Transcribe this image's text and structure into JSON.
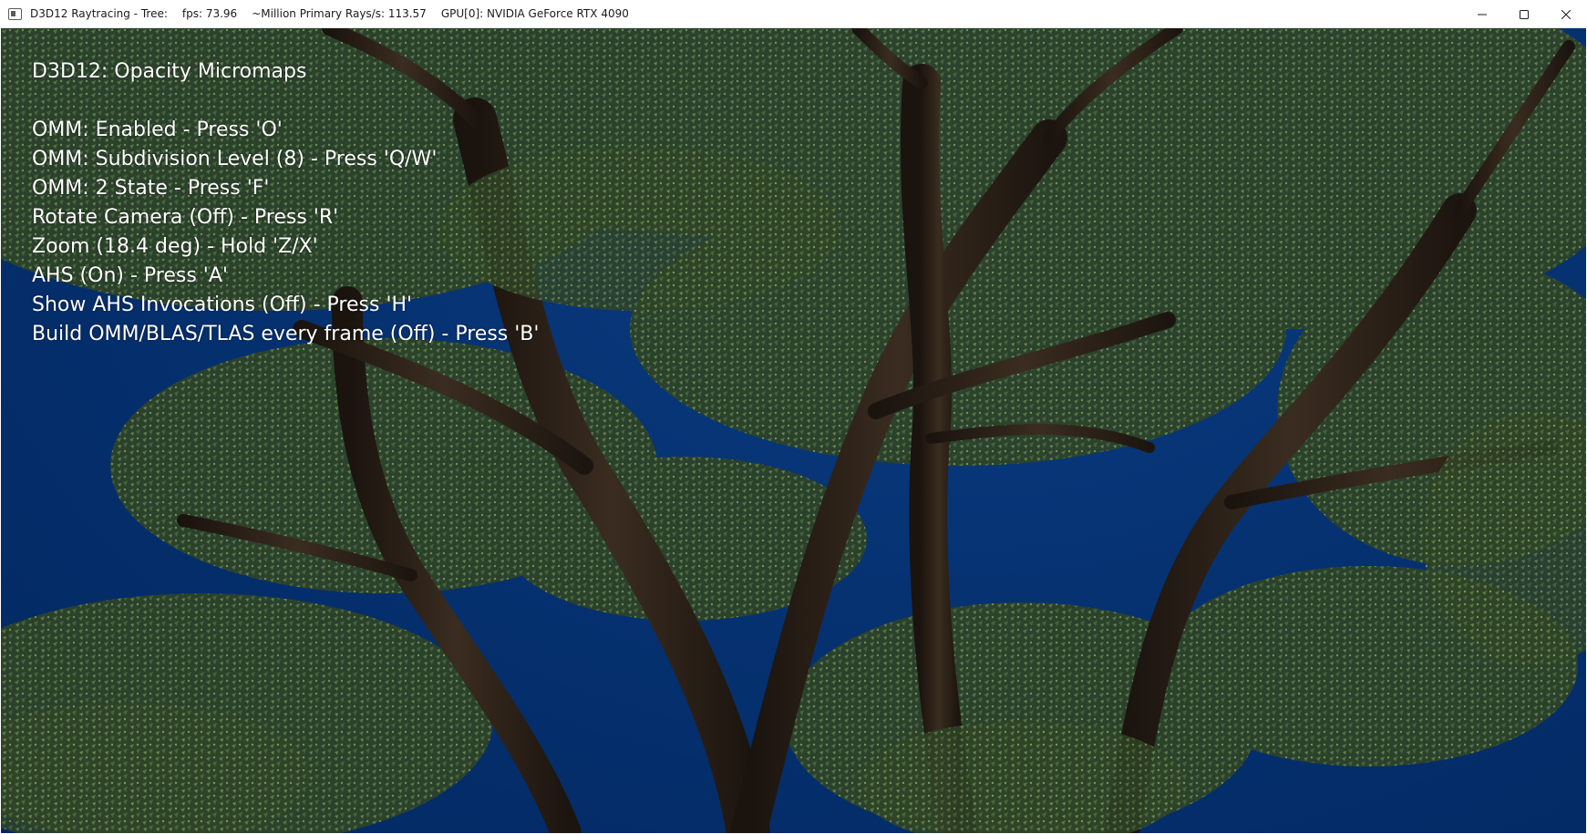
{
  "window": {
    "title_segments": [
      "D3D12 Raytracing - Tree:",
      "fps: 73.96",
      "~Million Primary Rays/s: 113.57",
      "GPU[0]: NVIDIA GeForce RTX 4090"
    ],
    "app_icon": "window-app-icon",
    "caption_buttons": [
      {
        "name": "minimize-icon"
      },
      {
        "name": "maximize-icon"
      },
      {
        "name": "close-icon"
      }
    ]
  },
  "hud": {
    "title": "D3D12: Opacity Micromaps",
    "lines": [
      "OMM: Enabled - Press 'O'",
      "OMM: Subdivision Level (8) - Press 'Q/W'",
      "OMM: 2 State - Press 'F'",
      "Rotate Camera (Off) - Press 'R'",
      "Zoom (18.4 deg) - Hold 'Z/X'",
      "AHS (On) - Press 'A'",
      "Show AHS Invocations (Off) - Press 'H'",
      "Build OMM/BLAS/TLAS every frame (Off) - Press 'B'"
    ]
  },
  "scene": {
    "sky_color": "#063272",
    "foliage_color": "#3f5a32",
    "bark_color": "#2a2018"
  }
}
